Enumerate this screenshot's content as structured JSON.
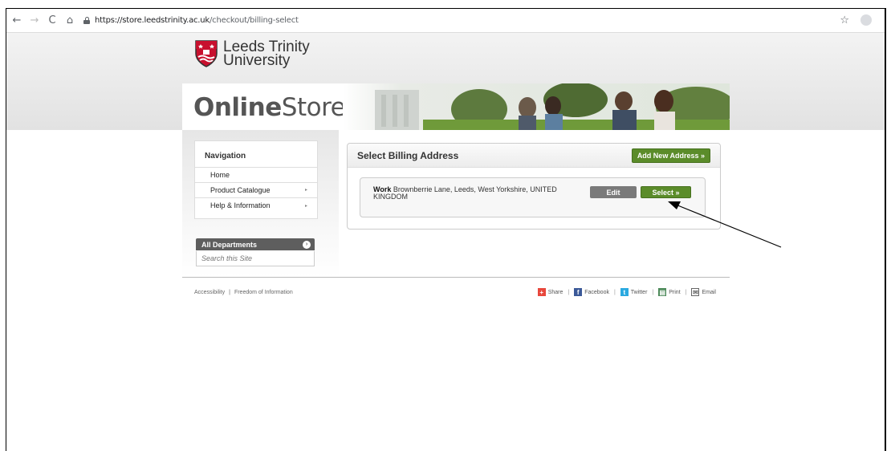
{
  "browser": {
    "url_host": "https://store.leedstrinity.ac.uk",
    "url_path": "/checkout/billing-select"
  },
  "brand": {
    "university_line1": "Leeds Trinity",
    "university_line2": "University",
    "store_bold": "Online",
    "store_light": "Store"
  },
  "navigation": {
    "heading": "Navigation",
    "items": [
      {
        "label": "Home",
        "has_submenu": false
      },
      {
        "label": "Product Catalogue",
        "has_submenu": true
      },
      {
        "label": "Help & Information",
        "has_submenu": true
      }
    ]
  },
  "search": {
    "departments_label": "All Departments",
    "placeholder": "Search this Site"
  },
  "billing": {
    "title": "Select Billing Address",
    "add_button": "Add New Address »",
    "address_name": "Work",
    "address_line": "Brownberrie Lane, Leeds, West Yorkshire, UNITED KINGDOM",
    "edit_button": "Edit",
    "select_button": "Select »"
  },
  "footer": {
    "links": [
      "Accessibility",
      "Freedom of Information"
    ],
    "share": [
      {
        "label": "Share",
        "icon": "share-icon",
        "color": "#e8473c"
      },
      {
        "label": "Facebook",
        "icon": "facebook-icon",
        "color": "#3b5998"
      },
      {
        "label": "Twitter",
        "icon": "twitter-icon",
        "color": "#2aa9e0"
      },
      {
        "label": "Print",
        "icon": "print-icon",
        "color": "#4d8a5a"
      },
      {
        "label": "Email",
        "icon": "email-icon",
        "color": "#666666"
      }
    ]
  },
  "colors": {
    "accent_green": "#5b8c2a",
    "edit_grey": "#7a7a7a"
  }
}
